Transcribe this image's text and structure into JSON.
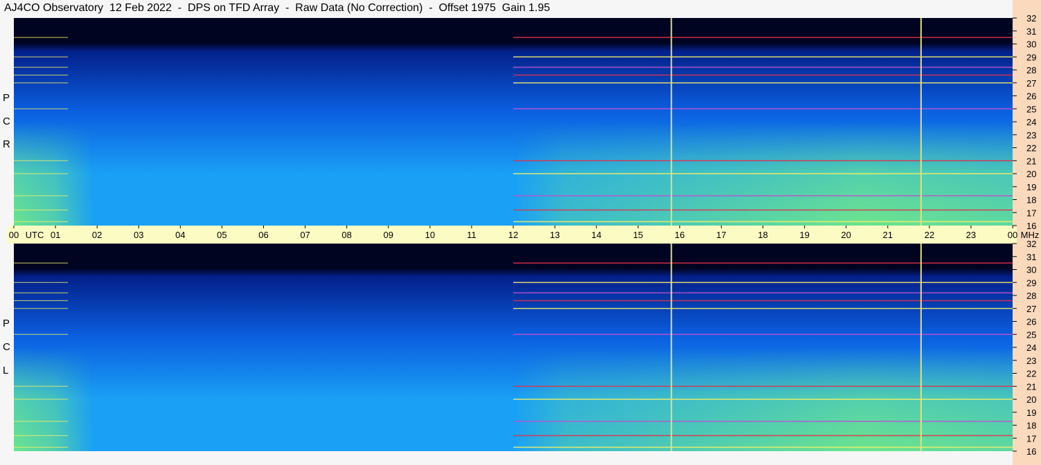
{
  "title": "AJ4CO Observatory  12 Feb 2022  -  DPS on TFD Array  -  Raw Data (No Correction)  -  Offset 1975  Gain 1.95",
  "panels": [
    {
      "id": "rcp",
      "label": [
        "P",
        "C",
        "R"
      ]
    },
    {
      "id": "lcp",
      "label": [
        "P",
        "C",
        "L"
      ]
    }
  ],
  "colors": {
    "background": "#f6f6f6",
    "axis_strip": "#fad9bd",
    "time_axis": "#fdfbc4",
    "dark": "#000420",
    "deep": "#03208a",
    "mid": "#0b5fe0",
    "bright": "#1aa0f5",
    "cyan": "#22d4e8",
    "green": "#7cf07a",
    "yellow": "#f2f06a",
    "magenta": "#c050d0",
    "red": "#e0304a",
    "vline": "#e6e080"
  },
  "chart_data": {
    "type": "heatmap",
    "title": "AJ4CO Observatory  12 Feb 2022  -  DPS on TFD Array  -  Raw Data (No Correction)  -  Offset 1975  Gain 1.95",
    "x_axis": {
      "label": "UTC",
      "unit_label": "MHz",
      "range": [
        0,
        24
      ],
      "ticks": [
        "00",
        "01",
        "02",
        "03",
        "04",
        "05",
        "06",
        "07",
        "08",
        "09",
        "10",
        "11",
        "12",
        "13",
        "14",
        "15",
        "16",
        "17",
        "18",
        "19",
        "20",
        "21",
        "22",
        "23",
        "00"
      ]
    },
    "y_axis": {
      "unit": "MHz",
      "range": [
        16,
        32
      ],
      "ticks": [
        "32",
        "31",
        "30",
        "29",
        "28",
        "27",
        "26",
        "25",
        "24",
        "23",
        "22",
        "21",
        "20",
        "19",
        "18",
        "17",
        "16"
      ]
    },
    "series": [
      {
        "name": "RCP",
        "label": "R C P"
      },
      {
        "name": "LCP",
        "label": "L C P"
      }
    ],
    "interference_lines_mhz": [
      30.5,
      29.0,
      28.2,
      27.6,
      27.0,
      25.0,
      21.0,
      20.0,
      18.3,
      17.2,
      16.3
    ],
    "vertical_markers_utc": [
      15.8,
      21.8
    ],
    "high_activity_utc": [
      [
        0,
        2
      ],
      [
        12,
        24
      ]
    ]
  }
}
